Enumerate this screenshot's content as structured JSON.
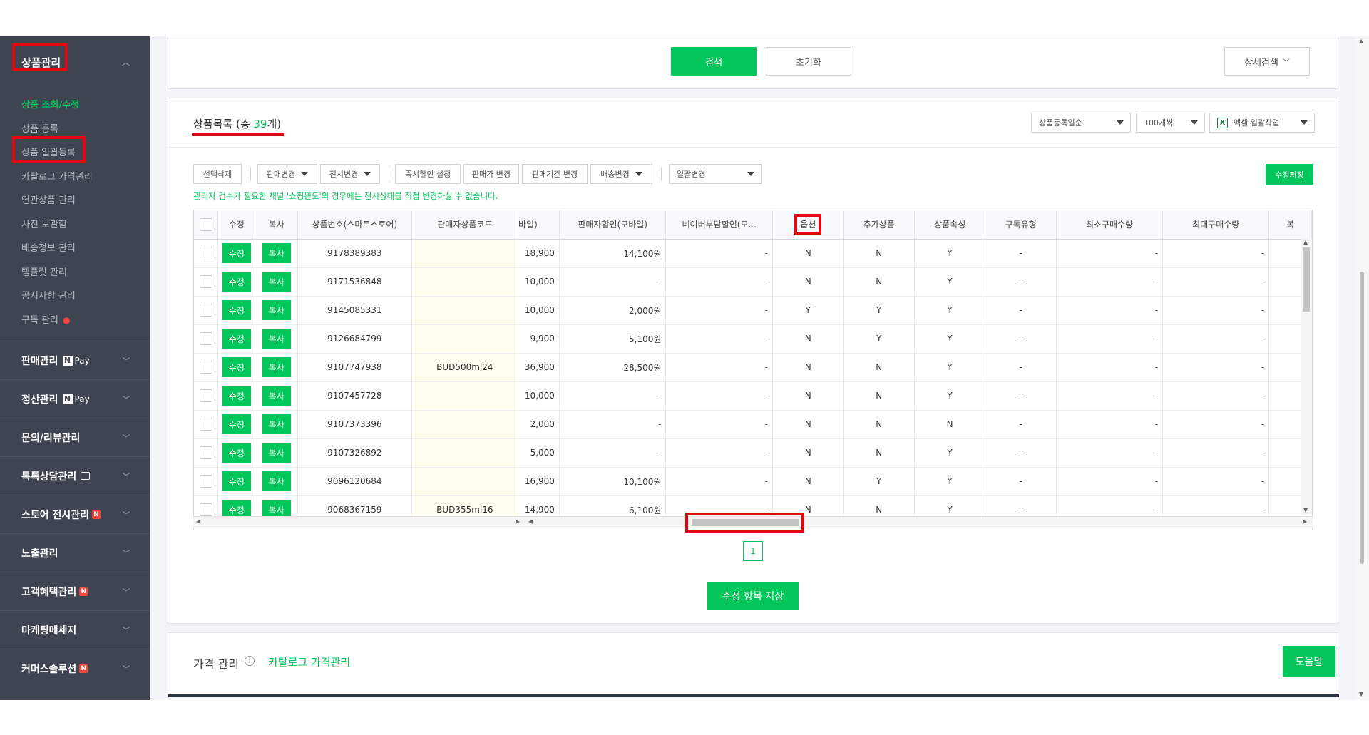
{
  "sidebar": {
    "product_mgmt": {
      "title": "상품관리",
      "items": [
        {
          "label": "상품 조회/수정"
        },
        {
          "label": "상품 등록"
        },
        {
          "label": "상품 일괄등록"
        },
        {
          "label": "카탈로그 가격관리"
        },
        {
          "label": "연관상품 관리"
        },
        {
          "label": "사진 보관함"
        },
        {
          "label": "배송정보 관리"
        },
        {
          "label": "템플릿 관리"
        },
        {
          "label": "공지사항 관리"
        },
        {
          "label": "구독 관리"
        }
      ]
    },
    "groups": [
      {
        "label": "판매관리",
        "npay": "Pay"
      },
      {
        "label": "정산관리",
        "npay": "Pay"
      },
      {
        "label": "문의/리뷰관리"
      },
      {
        "label": "톡톡상담관리"
      },
      {
        "label": "스토어 전시관리",
        "badge": "N"
      },
      {
        "label": "노출관리"
      },
      {
        "label": "고객혜택관리",
        "badge": "N"
      },
      {
        "label": "마케팅메세지"
      },
      {
        "label": "커머스솔루션",
        "badge": "N"
      }
    ]
  },
  "search": {
    "search_button": "검색",
    "reset_button": "초기화",
    "detail_search": "상세검색"
  },
  "list": {
    "title_prefix": "상품목록 (총 ",
    "count": "39",
    "title_suffix": "개)",
    "sort_select": "상품등록일순",
    "page_size_select": "100개씩",
    "excel_select": "엑셀 일괄작업",
    "toolbar": {
      "delete": "선택삭제",
      "sale_change": "판매변경",
      "display_change": "전시변경",
      "instant_discount": "즉시할인 설정",
      "price_change": "판매가 변경",
      "period_change": "판매기간 변경",
      "delivery_change": "배송변경",
      "bulk_change": "일괄변경",
      "save_edits": "수정저장"
    },
    "notice": "관리자 검수가 필요한 채널 '쇼핑윈도'의 경우에는 전시상태를 직접 변경하실 수 없습니다.",
    "columns": [
      "수정",
      "복사",
      "상품번호(스마트스토어)",
      "판매자상품코드",
      "바일)",
      "판매자할인(모바일)",
      "네이버부담할인(모...",
      "옵션",
      "추가상품",
      "상품속성",
      "구독유형",
      "최소구매수량",
      "최대구매수량",
      "복"
    ],
    "edit_label": "수정",
    "copy_label": "복사",
    "rows": [
      {
        "id": "9178389383",
        "code": "",
        "price": "18,900",
        "discount": "14,100원",
        "naver": "-",
        "option": "N",
        "addon": "N",
        "attr": "Y",
        "sub": "-",
        "min": "-",
        "max": "-"
      },
      {
        "id": "9171536848",
        "code": "",
        "price": "10,000",
        "discount": "-",
        "naver": "-",
        "option": "N",
        "addon": "N",
        "attr": "Y",
        "sub": "-",
        "min": "-",
        "max": "-"
      },
      {
        "id": "9145085331",
        "code": "",
        "price": "10,000",
        "discount": "2,000원",
        "naver": "-",
        "option": "Y",
        "addon": "Y",
        "attr": "Y",
        "sub": "-",
        "min": "-",
        "max": "-"
      },
      {
        "id": "9126684799",
        "code": "",
        "price": "9,900",
        "discount": "5,100원",
        "naver": "-",
        "option": "N",
        "addon": "Y",
        "attr": "Y",
        "sub": "-",
        "min": "-",
        "max": "-"
      },
      {
        "id": "9107747938",
        "code": "BUD500ml24",
        "price": "36,900",
        "discount": "28,500원",
        "naver": "-",
        "option": "N",
        "addon": "N",
        "attr": "Y",
        "sub": "-",
        "min": "-",
        "max": "-"
      },
      {
        "id": "9107457728",
        "code": "",
        "price": "10,000",
        "discount": "-",
        "naver": "-",
        "option": "N",
        "addon": "N",
        "attr": "Y",
        "sub": "-",
        "min": "-",
        "max": "-"
      },
      {
        "id": "9107373396",
        "code": "",
        "price": "2,000",
        "discount": "-",
        "naver": "-",
        "option": "N",
        "addon": "N",
        "attr": "N",
        "sub": "-",
        "min": "-",
        "max": "-"
      },
      {
        "id": "9107326892",
        "code": "",
        "price": "5,000",
        "discount": "-",
        "naver": "-",
        "option": "N",
        "addon": "N",
        "attr": "Y",
        "sub": "-",
        "min": "-",
        "max": "-"
      },
      {
        "id": "9096120684",
        "code": "",
        "price": "16,900",
        "discount": "10,100원",
        "naver": "-",
        "option": "N",
        "addon": "Y",
        "attr": "Y",
        "sub": "-",
        "min": "-",
        "max": "-"
      },
      {
        "id": "9068367159",
        "code": "BUD355ml16",
        "price": "14,900",
        "discount": "6,100원",
        "naver": "-",
        "option": "N",
        "addon": "N",
        "attr": "Y",
        "sub": "-",
        "min": "-",
        "max": "-"
      }
    ],
    "page_number": "1",
    "save_items_button": "수정 항목 저장"
  },
  "price_panel": {
    "title": "가격 관리",
    "link": "카탈로그 가격관리",
    "help_button": "도움말"
  },
  "colors": {
    "accent": "#03c75a",
    "sidebar_bg": "#3e4551",
    "highlight": "#e30613",
    "link_blue": "#2a6ec6"
  }
}
